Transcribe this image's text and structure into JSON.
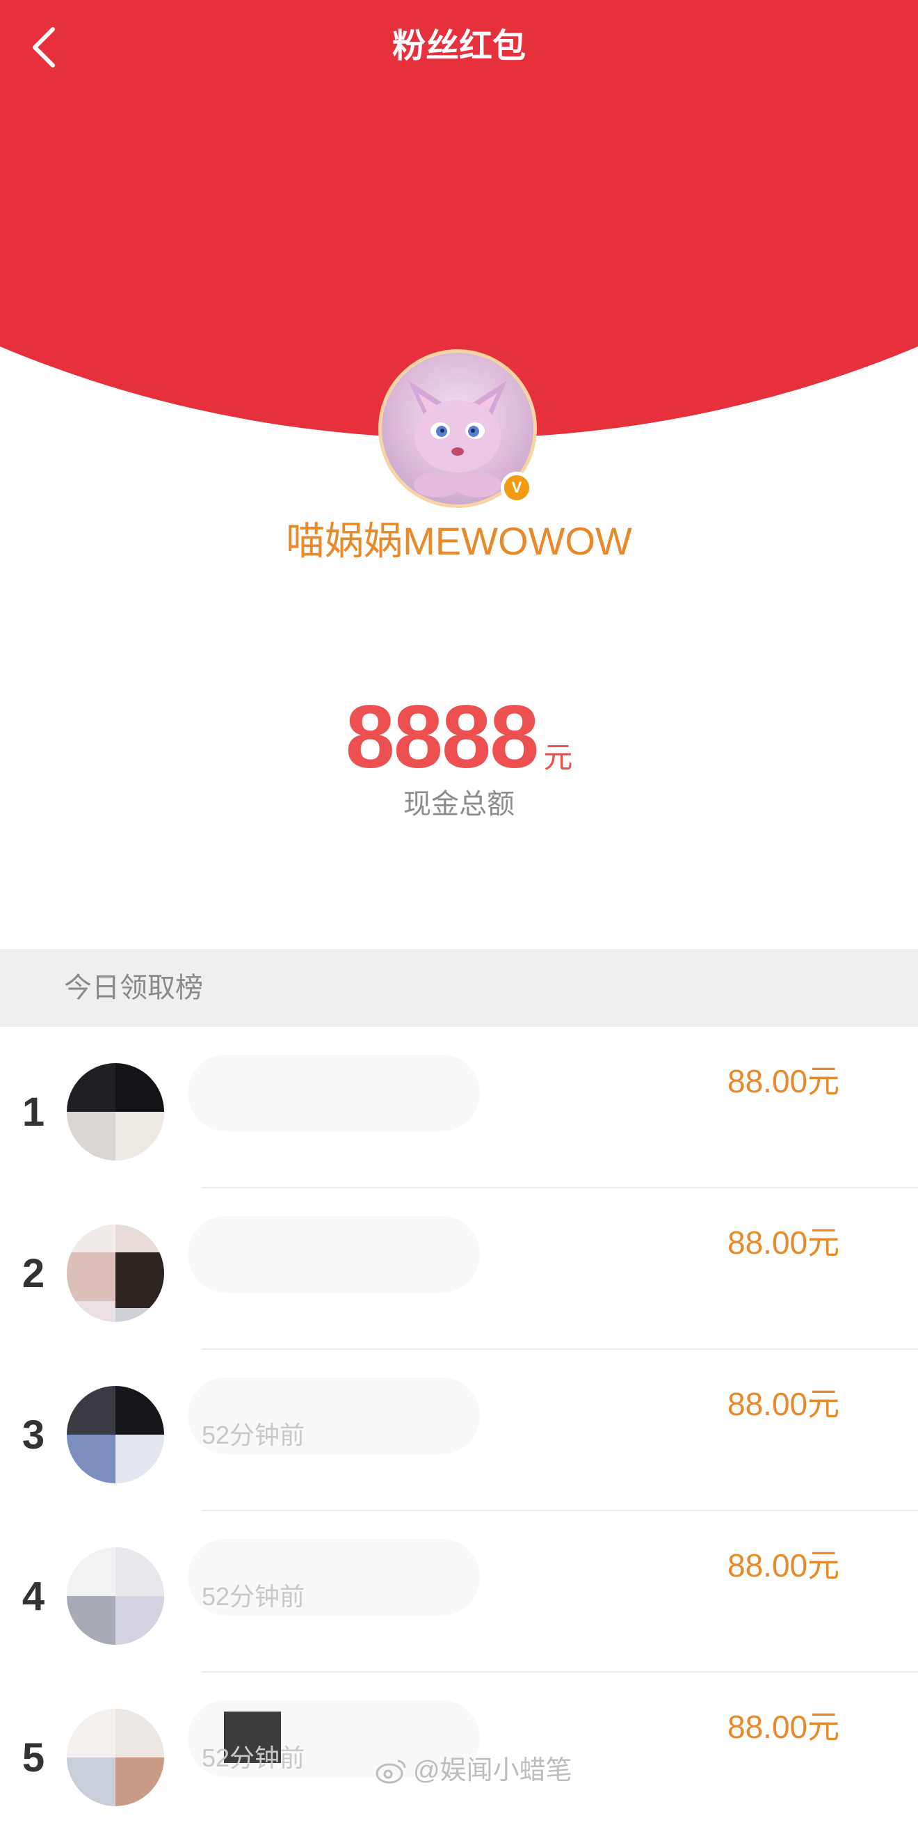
{
  "header": {
    "title": "粉丝红包",
    "back_icon": "chevron-left-icon",
    "background_color": "#e6303c"
  },
  "profile": {
    "name": "喵娲娲MEWOWOW",
    "avatar": "pink-cat-character-avatar",
    "verified_badge": "V"
  },
  "total": {
    "amount": "8888",
    "unit": "元",
    "label": "现金总额",
    "amount_color": "#ec5050"
  },
  "leaderboard": {
    "title": "今日领取榜",
    "rows": [
      {
        "rank": "1",
        "amount": "88.00元",
        "sub": ""
      },
      {
        "rank": "2",
        "amount": "88.00元",
        "sub": ""
      },
      {
        "rank": "3",
        "amount": "88.00元",
        "sub": "52分钟前"
      },
      {
        "rank": "4",
        "amount": "88.00元",
        "sub": "52分钟前"
      },
      {
        "rank": "5",
        "amount": "88.00元",
        "sub": "52分钟前"
      }
    ],
    "amount_color": "#e8892a"
  },
  "watermark": {
    "text": "@娱闻小蜡笔",
    "icon": "weibo-icon"
  }
}
